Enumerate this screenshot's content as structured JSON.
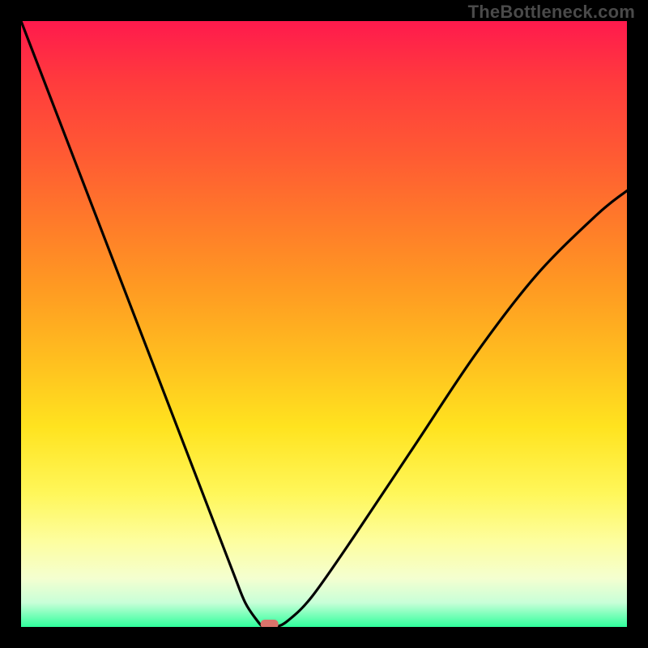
{
  "watermark": "TheBottleneck.com",
  "chart_data": {
    "type": "line",
    "title": "",
    "xlabel": "",
    "ylabel": "",
    "xlim": [
      0,
      100
    ],
    "ylim": [
      0,
      100
    ],
    "x": [
      0,
      5,
      10,
      15,
      20,
      25,
      30,
      35,
      37,
      39,
      40,
      41,
      42,
      44,
      48,
      55,
      65,
      75,
      85,
      95,
      100
    ],
    "values": [
      100,
      87,
      74,
      61,
      48,
      35,
      22,
      9,
      4,
      1,
      0,
      0,
      0,
      1,
      5,
      15,
      30,
      45,
      58,
      68,
      72
    ],
    "series": [
      {
        "name": "bottleneck-curve",
        "color": "#000000"
      }
    ],
    "marker": {
      "x": 41,
      "y": 0,
      "color": "#d9736b"
    },
    "background": {
      "type": "vertical-gradient",
      "top_color": "#ff1a4d",
      "bottom_color": "#2fff9c"
    }
  }
}
